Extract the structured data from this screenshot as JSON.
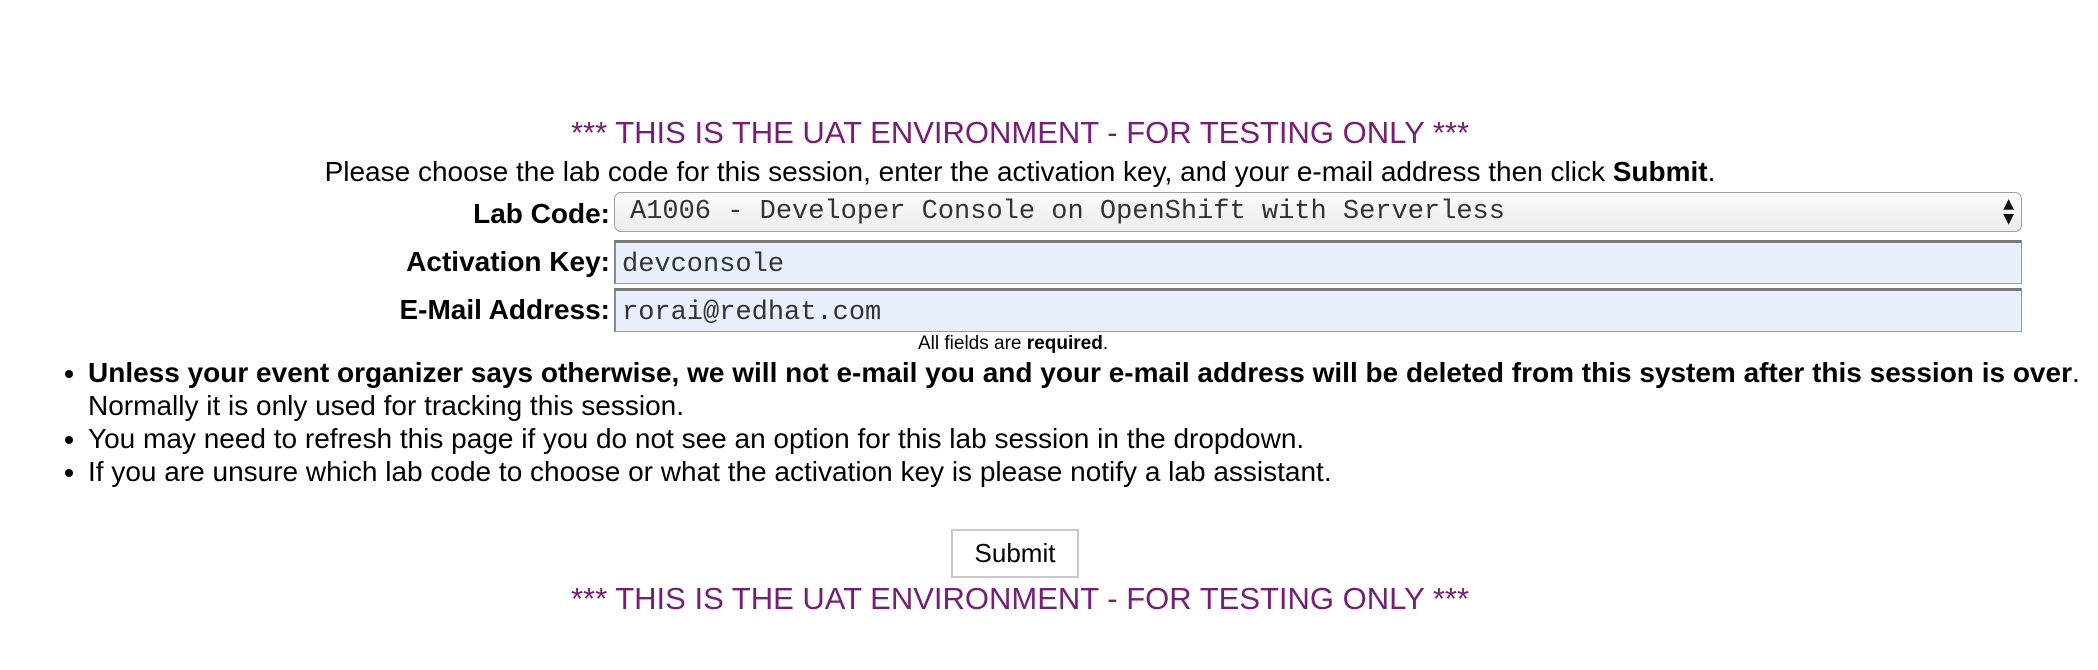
{
  "banner": {
    "top_text": "*** THIS IS THE UAT ENVIRONMENT - FOR TESTING ONLY ***",
    "bottom_text": "*** THIS IS THE UAT ENVIRONMENT - FOR TESTING ONLY ***",
    "color": "#7a1a7a"
  },
  "intro": {
    "text": "Please choose the lab code for this session, enter the activation key, and your e-mail address then click ",
    "emphasis": "Submit",
    "end": "."
  },
  "form": {
    "lab_code": {
      "label": "Lab Code:",
      "selected": "A1006 - Developer Console on OpenShift with Serverless"
    },
    "activation_key": {
      "label": "Activation Key:",
      "value": "devconsole"
    },
    "email": {
      "label": "E-Mail Address:",
      "value": "rorai@redhat.com"
    },
    "required_note": {
      "prefix": "All fields are ",
      "emphasis": "required",
      "suffix": "."
    }
  },
  "notes": [
    {
      "bold": "Unless your event organizer says otherwise, we will not e-mail you and your e-mail address will be deleted from this system after this session is over",
      "text": ". Normally it is only used for tracking this session."
    },
    {
      "text": "You may need to refresh this page if you do not see an option for this lab session in the dropdown."
    },
    {
      "text": "If you are unsure which lab code to choose or what the activation key is please notify a lab assistant."
    }
  ],
  "submit_label": "Submit",
  "field_background": "#e8f0fe"
}
